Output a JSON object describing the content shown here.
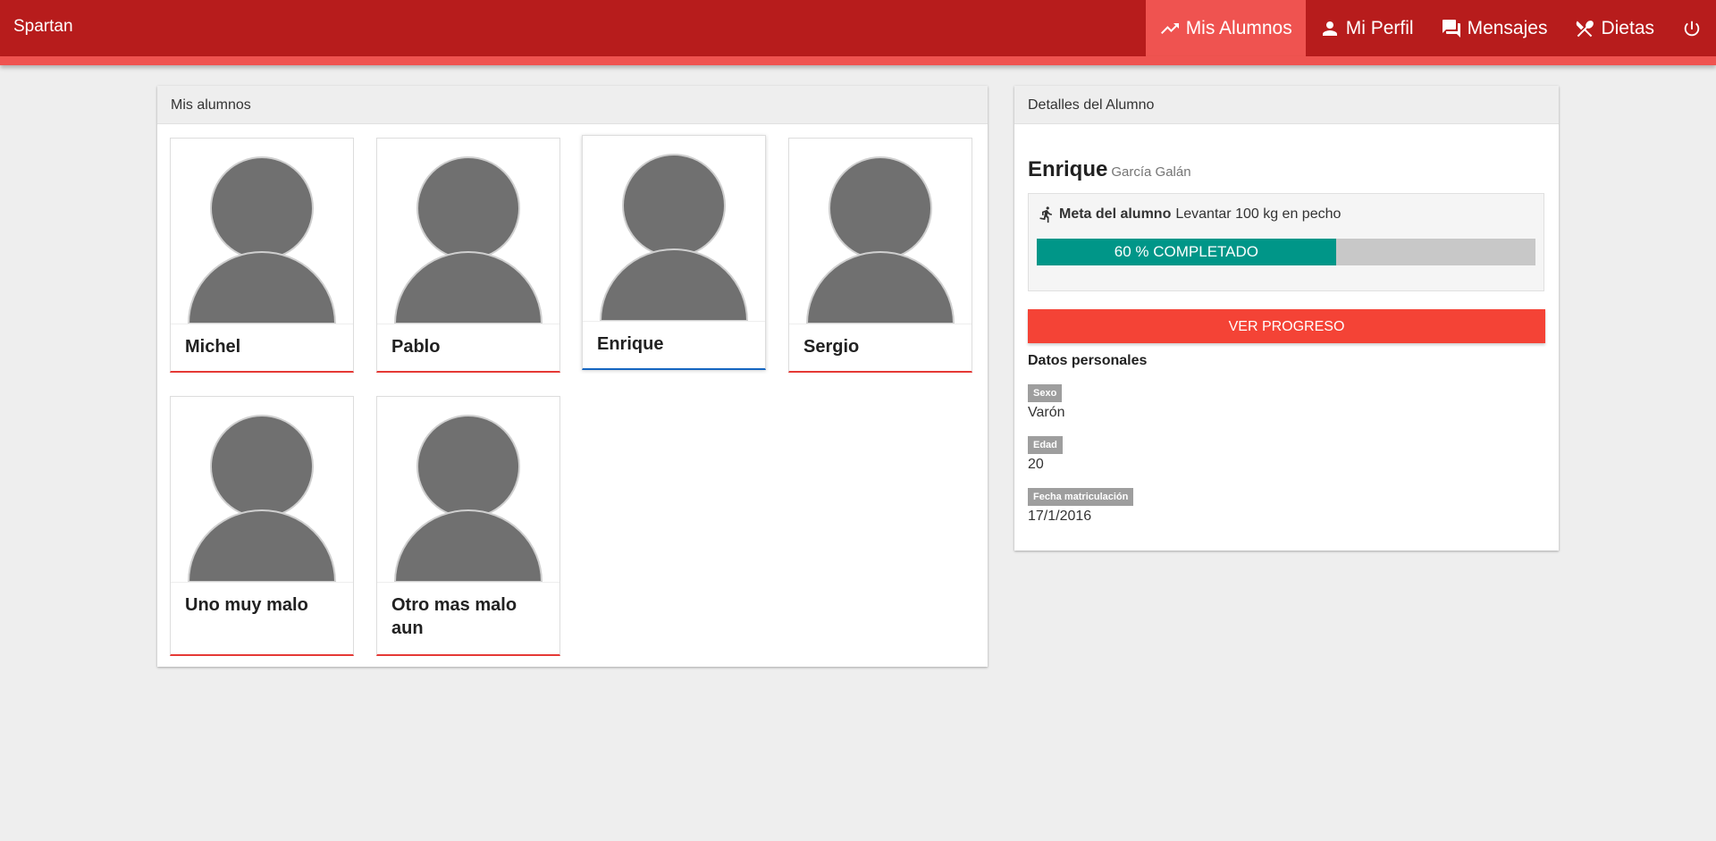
{
  "navbar": {
    "brand": "Spartan",
    "items": [
      {
        "label": "Mis Alumnos",
        "icon": "trending-up-icon",
        "active": true
      },
      {
        "label": "Mi Perfil",
        "icon": "person-icon",
        "active": false
      },
      {
        "label": "Mensajes",
        "icon": "forum-icon",
        "active": false
      },
      {
        "label": "Dietas",
        "icon": "cutlery-icon",
        "active": false
      }
    ],
    "power_icon": "power-icon"
  },
  "students_panel": {
    "title": "Mis alumnos",
    "students": [
      {
        "name": "Michel"
      },
      {
        "name": "Pablo"
      },
      {
        "name": "Enrique",
        "selected": true
      },
      {
        "name": "Sergio"
      },
      {
        "name": "Uno muy malo"
      },
      {
        "name": "Otro mas malo aun"
      }
    ]
  },
  "details_panel": {
    "title": "Detalles del Alumno",
    "first_name": "Enrique",
    "last_name": "García Galán",
    "goal_label": "Meta del alumno",
    "goal_text": "Levantar 100 kg en pecho",
    "progress_percent": 60,
    "progress_text": "60 % COMPLETADO",
    "progress_button": "VER PROGRESO",
    "personal_title": "Datos personales",
    "fields": [
      {
        "label": "Sexo",
        "value": "Varón"
      },
      {
        "label": "Edad",
        "value": "20"
      },
      {
        "label": "Fecha matriculación",
        "value": "17/1/2016"
      }
    ]
  },
  "colors": {
    "navbar": "#b71c1c",
    "accent": "#ef5350",
    "button": "#f44336",
    "progress": "#009688"
  }
}
